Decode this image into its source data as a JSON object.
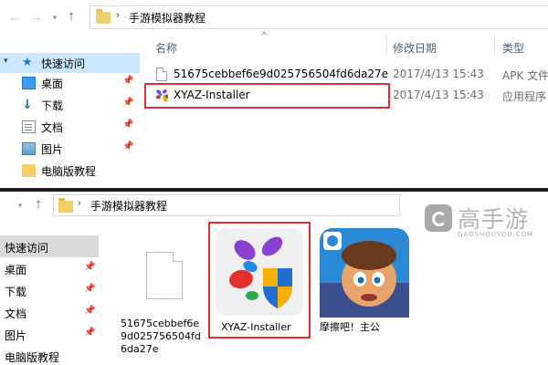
{
  "top_window": {
    "address_path": "手游模拟器教程",
    "columns": {
      "name": "名称",
      "date": "修改日期",
      "type": "类型"
    },
    "sidebar": [
      {
        "label": "快速访问",
        "icon": "star-icon",
        "active": true,
        "pinned": false
      },
      {
        "label": "桌面",
        "icon": "desktop-icon",
        "pinned": true
      },
      {
        "label": "下载",
        "icon": "download-icon",
        "pinned": true
      },
      {
        "label": "文档",
        "icon": "document-icon",
        "pinned": true
      },
      {
        "label": "图片",
        "icon": "pictures-icon",
        "pinned": true
      },
      {
        "label": "电脑版教程",
        "icon": "folder-icon",
        "pinned": false
      }
    ],
    "files": [
      {
        "name": "51675cebbef6e9d025756504fd6da27e",
        "date": "2017/4/13 15:43",
        "type": "APK 文件"
      },
      {
        "name": "XYAZ-Installer",
        "date": "2017/4/13 15:43",
        "type": "应用程序"
      }
    ]
  },
  "bottom_window": {
    "address_path": "手游模拟器教程",
    "sidebar": [
      {
        "label": "快速访问",
        "active": true,
        "pinned": false
      },
      {
        "label": "桌面",
        "pinned": true
      },
      {
        "label": "下载",
        "pinned": true
      },
      {
        "label": "文档",
        "pinned": true
      },
      {
        "label": "图片",
        "pinned": true
      },
      {
        "label": "电脑版教程",
        "pinned": false
      }
    ],
    "tiles": [
      {
        "caption_lines": [
          "51675cebbef6e",
          "9d025756504fd",
          "6da27e"
        ]
      },
      {
        "caption_lines": [
          "XYAZ-Installer"
        ]
      },
      {
        "caption_lines": [
          "摩擦吧！主公"
        ]
      }
    ]
  },
  "watermark": {
    "name": "高手游",
    "domain": "GAOSHOUYOU.COM"
  },
  "colors": {
    "highlight": "#e0312e",
    "quick_access_bg": "#cce8ff",
    "folder": "#f3cf6a"
  }
}
